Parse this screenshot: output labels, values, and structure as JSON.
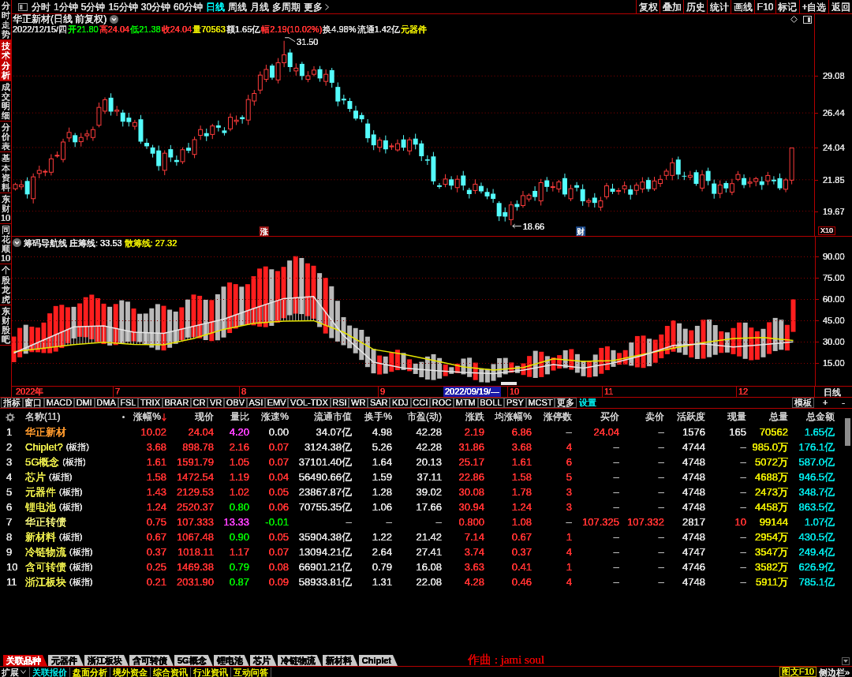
{
  "sidebar": {
    "items": [
      {
        "label": "分时走势",
        "selected": false
      },
      {
        "label": "技术分析",
        "selected": true
      },
      {
        "label": "成交明细",
        "selected": false
      },
      {
        "label": "分价表",
        "selected": false
      },
      {
        "label": "基本资料",
        "selected": false
      },
      {
        "label": "东财10",
        "selected": false
      },
      {
        "label": "同花顺10",
        "selected": false
      },
      {
        "label": "个股龙虎",
        "selected": false
      },
      {
        "label": "东财股吧",
        "selected": false
      }
    ]
  },
  "toolbar": {
    "periods": [
      {
        "label": "分时",
        "selected": false
      },
      {
        "label": "1分钟",
        "selected": false
      },
      {
        "label": "5分钟",
        "selected": false
      },
      {
        "label": "15分钟",
        "selected": false
      },
      {
        "label": "30分钟",
        "selected": false
      },
      {
        "label": "60分钟",
        "selected": false
      },
      {
        "label": "日线",
        "selected": true
      },
      {
        "label": "周线",
        "selected": false
      },
      {
        "label": "月线",
        "selected": false
      },
      {
        "label": "多周期",
        "selected": false
      }
    ],
    "more": "更多",
    "actions": [
      "复权",
      "叠加",
      "历史",
      "统计",
      "画线",
      "F10",
      "标记",
      "+自选",
      "返回"
    ]
  },
  "chart_header": {
    "title": "华正新材(日线 前复权)",
    "date": "2022/12/15/四",
    "fields": [
      {
        "text": "开21.80",
        "color": "#00e600"
      },
      {
        "text": "高24.04",
        "color": "#ff3232"
      },
      {
        "text": "低21.38",
        "color": "#00e600"
      },
      {
        "text": "收24.04",
        "color": "#ff3232"
      },
      {
        "text": "量70563",
        "color": "#e6e600"
      },
      {
        "text": "额1.65亿",
        "color": "#dcdcdc"
      },
      {
        "text": "幅2.19(10.02%)",
        "color": "#ff3232"
      },
      {
        "text": "换4.98%",
        "color": "#dcdcdc"
      },
      {
        "text": "流通1.42亿",
        "color": "#dcdcdc"
      },
      {
        "text": "元器件",
        "color": "#e6e600"
      }
    ]
  },
  "price_chart": {
    "axis_labels": [
      "29.08",
      "26.44",
      "24.04",
      "21.85",
      "19.67"
    ],
    "high_label": "31.50",
    "low_label": "18.66",
    "markers": [
      {
        "text": "涨",
        "color": "#a01818"
      },
      {
        "text": "财",
        "color": "#1c4a8c"
      }
    ],
    "scale_button": "X10"
  },
  "indicator_panel": {
    "name": "筹码导航线",
    "chart_data": {
      "type": "line",
      "ylim": [
        -1.11,
        104.2
      ],
      "yticks": [
        {
          "value": 90,
          "label": "90.00"
        },
        {
          "value": 75,
          "label": "75.00"
        },
        {
          "value": 60,
          "label": "60.00"
        },
        {
          "value": 45,
          "label": "45.00"
        },
        {
          "value": 30,
          "label": "30.00"
        },
        {
          "value": 15,
          "label": "15.00"
        }
      ],
      "grid": true,
      "series": [
        {
          "name": "庄筹线: 33.53",
          "color": "#e6e6e6",
          "values": [
            22,
            31.4,
            40.5,
            41.3,
            36.7,
            36,
            41,
            46,
            53.5,
            60.5,
            62,
            34.3,
            15.6,
            11.4,
            9.8,
            8.3,
            7.5,
            10,
            14,
            11.5,
            15,
            20.5,
            27.5,
            28.6,
            26.3,
            28,
            30
          ]
        },
        {
          "name": "散筹线: 27.32",
          "color": "#e6e600",
          "values": [
            23,
            25.5,
            28,
            29.7,
            28.2,
            27.9,
            32.3,
            38.8,
            43,
            44.5,
            44.9,
            36.8,
            24.6,
            21.2,
            16.9,
            12.3,
            10,
            11.9,
            18,
            16.1,
            16.8,
            21.2,
            25.5,
            29.4,
            32.3,
            33,
            31
          ]
        }
      ]
    }
  },
  "date_axis": {
    "labels": [
      "2022年",
      "7",
      "8",
      "9",
      "10",
      "11",
      "12"
    ],
    "cursor_date": "2022/09/19/—",
    "period": "日线"
  },
  "indicator_tabs": {
    "items": [
      {
        "label": "指标",
        "kind": "tab"
      },
      {
        "label": "窗口",
        "kind": "tab"
      },
      {
        "label": "MACD",
        "kind": "tab"
      },
      {
        "label": "DMI",
        "kind": "tab"
      },
      {
        "label": "DMA",
        "kind": "tab"
      },
      {
        "label": "FSL",
        "kind": "tab"
      },
      {
        "label": "TRIX",
        "kind": "tab"
      },
      {
        "label": "BRAR",
        "kind": "tab"
      },
      {
        "label": "CR",
        "kind": "tab"
      },
      {
        "label": "VR",
        "kind": "tab"
      },
      {
        "label": "OBV",
        "kind": "tab"
      },
      {
        "label": "ASI",
        "kind": "tab"
      },
      {
        "label": "EMV",
        "kind": "tab"
      },
      {
        "label": "VOL-TDX",
        "kind": "tab"
      },
      {
        "label": "RSI",
        "kind": "tab"
      },
      {
        "label": "WR",
        "kind": "tab"
      },
      {
        "label": "SAR",
        "kind": "tab"
      },
      {
        "label": "KDJ",
        "kind": "tab"
      },
      {
        "label": "CCI",
        "kind": "tab"
      },
      {
        "label": "ROC",
        "kind": "tab"
      },
      {
        "label": "MTM",
        "kind": "tab"
      },
      {
        "label": "BOLL",
        "kind": "tab"
      },
      {
        "label": "PSY",
        "kind": "tab"
      },
      {
        "label": "MCST",
        "kind": "tab"
      },
      {
        "label": "更多",
        "kind": "tab"
      },
      {
        "label": "设置",
        "kind": "setting"
      }
    ],
    "template": "模板",
    "add": "+",
    "remove": "-"
  },
  "table": {
    "columns": [
      {
        "kind": "settings"
      },
      {
        "kind": "name",
        "label": "名称(11)",
        "sorted": false
      },
      {
        "kind": "number",
        "label": "涨幅%",
        "sorted": true
      },
      {
        "kind": "number",
        "label": "现价",
        "sorted": false
      },
      {
        "kind": "number",
        "label": "量比",
        "sorted": false
      },
      {
        "kind": "number",
        "label": "涨速%",
        "sorted": false
      },
      {
        "kind": "number",
        "label": "流通市值",
        "sorted": false
      },
      {
        "kind": "number",
        "label": "换手%",
        "sorted": false
      },
      {
        "kind": "number",
        "label": "市盈(动)",
        "sorted": false
      },
      {
        "kind": "number",
        "label": "涨跌",
        "sorted": false
      },
      {
        "kind": "number",
        "label": "均涨幅%",
        "sorted": false
      },
      {
        "kind": "number",
        "label": "涨停数",
        "sorted": false
      },
      {
        "kind": "number",
        "label": "买价",
        "sorted": false
      },
      {
        "kind": "number",
        "label": "卖价",
        "sorted": false
      },
      {
        "kind": "number",
        "label": "活跃度",
        "sorted": false
      },
      {
        "kind": "number",
        "label": "现量",
        "sorted": false
      },
      {
        "kind": "number",
        "label": "总量",
        "sorted": false
      },
      {
        "kind": "number",
        "label": "总金额",
        "sorted": false
      }
    ],
    "rows": [
      {
        "cells": [
          {
            "text": "1"
          },
          {
            "text": "华正新材",
            "color": "#ff9a2e"
          },
          {
            "text": "10.02",
            "color": "#ff3232"
          },
          {
            "text": "24.04",
            "color": "#ff3232"
          },
          {
            "text": "4.20",
            "color": "#ff40ff"
          },
          {
            "text": "0.00",
            "color": "#dcdcdc"
          },
          {
            "text": "34.07亿",
            "color": "#dcdcdc"
          },
          {
            "text": "4.98",
            "color": "#dcdcdc"
          },
          {
            "text": "42.28",
            "color": "#dcdcdc"
          },
          {
            "text": "2.19",
            "color": "#ff3232"
          },
          {
            "text": "6.86",
            "color": "#ff3232"
          },
          {
            "text": "–",
            "color": "#c0c0c0"
          },
          {
            "text": "24.04",
            "color": "#ff3232"
          },
          {
            "text": "–",
            "color": "#c0c0c0"
          },
          {
            "text": "1576",
            "color": "#dcdcdc"
          },
          {
            "text": "165",
            "color": "#dcdcdc"
          },
          {
            "text": "70562",
            "color": "#e6e600"
          },
          {
            "text": "1.65亿",
            "color": "#00e0e0"
          }
        ]
      },
      {
        "cells": [
          {
            "text": "2"
          },
          {
            "text": "Chiplet?",
            "tag": "(板指)",
            "color": "#e6e64a"
          },
          {
            "text": "3.68",
            "color": "#ff3232"
          },
          {
            "text": "898.78",
            "color": "#ff3232"
          },
          {
            "text": "2.16",
            "color": "#ff3232"
          },
          {
            "text": "0.07",
            "color": "#ff3232"
          },
          {
            "text": "3124.38亿",
            "color": "#dcdcdc"
          },
          {
            "text": "5.26",
            "color": "#dcdcdc"
          },
          {
            "text": "42.28",
            "color": "#dcdcdc"
          },
          {
            "text": "31.86",
            "color": "#ff3232"
          },
          {
            "text": "3.68",
            "color": "#ff3232"
          },
          {
            "text": "4",
            "color": "#ff3232"
          },
          {
            "text": "–",
            "color": "#c0c0c0"
          },
          {
            "text": "–",
            "color": "#c0c0c0"
          },
          {
            "text": "4744",
            "color": "#dcdcdc"
          },
          {
            "text": "–",
            "color": "#c0c0c0"
          },
          {
            "text": "985.0万",
            "color": "#e6e600"
          },
          {
            "text": "176.1亿",
            "color": "#00e0e0"
          }
        ]
      },
      {
        "cells": [
          {
            "text": "3"
          },
          {
            "text": "5G概念",
            "tag": "(板指)",
            "color": "#e6e64a"
          },
          {
            "text": "1.61",
            "color": "#ff3232"
          },
          {
            "text": "1591.79",
            "color": "#ff3232"
          },
          {
            "text": "1.05",
            "color": "#ff3232"
          },
          {
            "text": "0.07",
            "color": "#ff3232"
          },
          {
            "text": "37101.40亿",
            "color": "#dcdcdc"
          },
          {
            "text": "1.64",
            "color": "#dcdcdc"
          },
          {
            "text": "20.13",
            "color": "#dcdcdc"
          },
          {
            "text": "25.17",
            "color": "#ff3232"
          },
          {
            "text": "1.61",
            "color": "#ff3232"
          },
          {
            "text": "6",
            "color": "#ff3232"
          },
          {
            "text": "–",
            "color": "#c0c0c0"
          },
          {
            "text": "–",
            "color": "#c0c0c0"
          },
          {
            "text": "4748",
            "color": "#dcdcdc"
          },
          {
            "text": "–",
            "color": "#c0c0c0"
          },
          {
            "text": "5072万",
            "color": "#e6e600"
          },
          {
            "text": "587.0亿",
            "color": "#00e0e0"
          }
        ]
      },
      {
        "cells": [
          {
            "text": "4"
          },
          {
            "text": "芯片",
            "tag": "(板指)",
            "color": "#e6e64a"
          },
          {
            "text": "1.58",
            "color": "#ff3232"
          },
          {
            "text": "1472.54",
            "color": "#ff3232"
          },
          {
            "text": "1.19",
            "color": "#ff3232"
          },
          {
            "text": "0.04",
            "color": "#ff3232"
          },
          {
            "text": "56490.66亿",
            "color": "#dcdcdc"
          },
          {
            "text": "1.59",
            "color": "#dcdcdc"
          },
          {
            "text": "37.11",
            "color": "#dcdcdc"
          },
          {
            "text": "22.86",
            "color": "#ff3232"
          },
          {
            "text": "1.58",
            "color": "#ff3232"
          },
          {
            "text": "5",
            "color": "#ff3232"
          },
          {
            "text": "–",
            "color": "#c0c0c0"
          },
          {
            "text": "–",
            "color": "#c0c0c0"
          },
          {
            "text": "4748",
            "color": "#dcdcdc"
          },
          {
            "text": "–",
            "color": "#c0c0c0"
          },
          {
            "text": "4688万",
            "color": "#e6e600"
          },
          {
            "text": "946.5亿",
            "color": "#00e0e0"
          }
        ]
      },
      {
        "cells": [
          {
            "text": "5"
          },
          {
            "text": "元器件",
            "tag": "(板指)",
            "color": "#e6e64a"
          },
          {
            "text": "1.43",
            "color": "#ff3232"
          },
          {
            "text": "2129.53",
            "color": "#ff3232"
          },
          {
            "text": "1.02",
            "color": "#ff3232"
          },
          {
            "text": "0.05",
            "color": "#ff3232"
          },
          {
            "text": "23867.87亿",
            "color": "#dcdcdc"
          },
          {
            "text": "1.28",
            "color": "#dcdcdc"
          },
          {
            "text": "39.02",
            "color": "#dcdcdc"
          },
          {
            "text": "30.08",
            "color": "#ff3232"
          },
          {
            "text": "1.78",
            "color": "#ff3232"
          },
          {
            "text": "3",
            "color": "#ff3232"
          },
          {
            "text": "–",
            "color": "#c0c0c0"
          },
          {
            "text": "–",
            "color": "#c0c0c0"
          },
          {
            "text": "4748",
            "color": "#dcdcdc"
          },
          {
            "text": "–",
            "color": "#c0c0c0"
          },
          {
            "text": "2473万",
            "color": "#e6e600"
          },
          {
            "text": "348.7亿",
            "color": "#00e0e0"
          }
        ]
      },
      {
        "cells": [
          {
            "text": "6"
          },
          {
            "text": "锂电池",
            "tag": "(板指)",
            "color": "#e6e64a"
          },
          {
            "text": "1.24",
            "color": "#ff3232"
          },
          {
            "text": "2520.37",
            "color": "#ff3232"
          },
          {
            "text": "0.80",
            "color": "#00e600"
          },
          {
            "text": "0.06",
            "color": "#ff3232"
          },
          {
            "text": "70755.35亿",
            "color": "#dcdcdc"
          },
          {
            "text": "1.06",
            "color": "#dcdcdc"
          },
          {
            "text": "17.66",
            "color": "#dcdcdc"
          },
          {
            "text": "30.94",
            "color": "#ff3232"
          },
          {
            "text": "1.24",
            "color": "#ff3232"
          },
          {
            "text": "3",
            "color": "#ff3232"
          },
          {
            "text": "–",
            "color": "#c0c0c0"
          },
          {
            "text": "–",
            "color": "#c0c0c0"
          },
          {
            "text": "4748",
            "color": "#dcdcdc"
          },
          {
            "text": "–",
            "color": "#c0c0c0"
          },
          {
            "text": "4458万",
            "color": "#e6e600"
          },
          {
            "text": "863.5亿",
            "color": "#00e0e0"
          }
        ]
      },
      {
        "cells": [
          {
            "text": "7"
          },
          {
            "text": "华正转债",
            "color": "#ecec78"
          },
          {
            "text": "0.75",
            "color": "#ff3232"
          },
          {
            "text": "107.333",
            "color": "#ff3232"
          },
          {
            "text": "13.33",
            "color": "#ff40ff"
          },
          {
            "text": "-0.01",
            "color": "#00e600"
          },
          {
            "text": "–",
            "color": "#c0c0c0"
          },
          {
            "text": "–",
            "color": "#c0c0c0"
          },
          {
            "text": "–",
            "color": "#c0c0c0"
          },
          {
            "text": "0.800",
            "color": "#ff3232"
          },
          {
            "text": "1.08",
            "color": "#ff3232"
          },
          {
            "text": "–",
            "color": "#c0c0c0"
          },
          {
            "text": "107.325",
            "color": "#ff3232"
          },
          {
            "text": "107.332",
            "color": "#ff3232"
          },
          {
            "text": "2817",
            "color": "#dcdcdc"
          },
          {
            "text": "10",
            "color": "#ff3232"
          },
          {
            "text": "99144",
            "color": "#e6e600"
          },
          {
            "text": "1.07亿",
            "color": "#00e0e0"
          }
        ]
      },
      {
        "cells": [
          {
            "text": "8"
          },
          {
            "text": "新材料",
            "tag": "(板指)",
            "color": "#e6e64a"
          },
          {
            "text": "0.67",
            "color": "#ff3232"
          },
          {
            "text": "1067.48",
            "color": "#ff3232"
          },
          {
            "text": "0.90",
            "color": "#00e600"
          },
          {
            "text": "0.05",
            "color": "#ff3232"
          },
          {
            "text": "35904.38亿",
            "color": "#dcdcdc"
          },
          {
            "text": "1.22",
            "color": "#dcdcdc"
          },
          {
            "text": "21.42",
            "color": "#dcdcdc"
          },
          {
            "text": "7.14",
            "color": "#ff3232"
          },
          {
            "text": "0.67",
            "color": "#ff3232"
          },
          {
            "text": "1",
            "color": "#ff3232"
          },
          {
            "text": "–",
            "color": "#c0c0c0"
          },
          {
            "text": "–",
            "color": "#c0c0c0"
          },
          {
            "text": "4748",
            "color": "#dcdcdc"
          },
          {
            "text": "–",
            "color": "#c0c0c0"
          },
          {
            "text": "2954万",
            "color": "#e6e600"
          },
          {
            "text": "430.5亿",
            "color": "#00e0e0"
          }
        ]
      },
      {
        "cells": [
          {
            "text": "9"
          },
          {
            "text": "冷链物流",
            "tag": "(板指)",
            "color": "#e6e64a"
          },
          {
            "text": "0.37",
            "color": "#ff3232"
          },
          {
            "text": "1018.11",
            "color": "#ff3232"
          },
          {
            "text": "1.17",
            "color": "#ff3232"
          },
          {
            "text": "0.07",
            "color": "#ff3232"
          },
          {
            "text": "13094.21亿",
            "color": "#dcdcdc"
          },
          {
            "text": "2.64",
            "color": "#dcdcdc"
          },
          {
            "text": "27.41",
            "color": "#dcdcdc"
          },
          {
            "text": "3.74",
            "color": "#ff3232"
          },
          {
            "text": "0.37",
            "color": "#ff3232"
          },
          {
            "text": "4",
            "color": "#ff3232"
          },
          {
            "text": "–",
            "color": "#c0c0c0"
          },
          {
            "text": "–",
            "color": "#c0c0c0"
          },
          {
            "text": "4747",
            "color": "#dcdcdc"
          },
          {
            "text": "–",
            "color": "#c0c0c0"
          },
          {
            "text": "3547万",
            "color": "#e6e600"
          },
          {
            "text": "249.4亿",
            "color": "#00e0e0"
          }
        ]
      },
      {
        "cells": [
          {
            "text": "10"
          },
          {
            "text": "含可转债",
            "tag": "(板指)",
            "color": "#e6e64a"
          },
          {
            "text": "0.25",
            "color": "#ff3232"
          },
          {
            "text": "1469.38",
            "color": "#ff3232"
          },
          {
            "text": "0.79",
            "color": "#00e600"
          },
          {
            "text": "0.08",
            "color": "#ff3232"
          },
          {
            "text": "66901.21亿",
            "color": "#dcdcdc"
          },
          {
            "text": "0.79",
            "color": "#dcdcdc"
          },
          {
            "text": "16.08",
            "color": "#dcdcdc"
          },
          {
            "text": "3.63",
            "color": "#ff3232"
          },
          {
            "text": "0.41",
            "color": "#ff3232"
          },
          {
            "text": "1",
            "color": "#ff3232"
          },
          {
            "text": "–",
            "color": "#c0c0c0"
          },
          {
            "text": "–",
            "color": "#c0c0c0"
          },
          {
            "text": "4746",
            "color": "#dcdcdc"
          },
          {
            "text": "–",
            "color": "#c0c0c0"
          },
          {
            "text": "3582万",
            "color": "#e6e600"
          },
          {
            "text": "626.9亿",
            "color": "#00e0e0"
          }
        ]
      },
      {
        "cells": [
          {
            "text": "11"
          },
          {
            "text": "浙江板块",
            "tag": "(板指)",
            "color": "#e6e64a"
          },
          {
            "text": "0.21",
            "color": "#ff3232"
          },
          {
            "text": "2031.90",
            "color": "#ff3232"
          },
          {
            "text": "0.87",
            "color": "#00e600"
          },
          {
            "text": "0.09",
            "color": "#ff3232"
          },
          {
            "text": "58933.81亿",
            "color": "#dcdcdc"
          },
          {
            "text": "1.31",
            "color": "#dcdcdc"
          },
          {
            "text": "22.08",
            "color": "#dcdcdc"
          },
          {
            "text": "4.28",
            "color": "#ff3232"
          },
          {
            "text": "0.46",
            "color": "#ff3232"
          },
          {
            "text": "4",
            "color": "#ff3232"
          },
          {
            "text": "–",
            "color": "#c0c0c0"
          },
          {
            "text": "–",
            "color": "#c0c0c0"
          },
          {
            "text": "4748",
            "color": "#dcdcdc"
          },
          {
            "text": "–",
            "color": "#c0c0c0"
          },
          {
            "text": "5911万",
            "color": "#e6e600"
          },
          {
            "text": "785.1亿",
            "color": "#00e0e0"
          }
        ]
      }
    ]
  },
  "bottom_tabs": {
    "items": [
      {
        "label": "关联品种",
        "selected": true
      },
      {
        "label": "元器件",
        "selected": false
      },
      {
        "label": "浙江板块",
        "selected": false
      },
      {
        "label": "含可转债",
        "selected": false
      },
      {
        "label": "5G概念",
        "selected": false
      },
      {
        "label": "锂电池",
        "selected": false
      },
      {
        "label": "芯片",
        "selected": false
      },
      {
        "label": "冷链物流",
        "selected": false
      },
      {
        "label": "新材料",
        "selected": false
      },
      {
        "label": "Chiplet",
        "selected": false
      }
    ],
    "credit": "作曲 : jami soul"
  },
  "bottom_bar": {
    "expand": "扩展",
    "links": [
      {
        "label": "关联报价",
        "selected": true
      },
      {
        "label": "盘面分析",
        "selected": false
      },
      {
        "label": "境外资金",
        "selected": false
      },
      {
        "label": "综合资讯",
        "selected": false
      },
      {
        "label": "行业资讯",
        "selected": false
      },
      {
        "label": "互动问答",
        "selected": false
      }
    ],
    "f10": "图文F10",
    "sidebar_toggle": "侧边栏»"
  }
}
